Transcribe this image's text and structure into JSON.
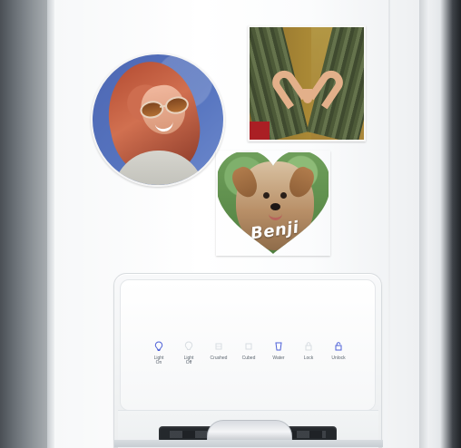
{
  "photo_magnets": {
    "heart_magnet": {
      "name_text": "Benji"
    }
  },
  "dispenser": {
    "controls": [
      {
        "label": "Light\nOn",
        "icon": "bulb-icon",
        "active": true
      },
      {
        "label": "Light\nOff",
        "icon": "bulb-off-icon",
        "active": false
      },
      {
        "label": "Crushed",
        "icon": "crushed-ice-icon",
        "active": false
      },
      {
        "label": "Cubed",
        "icon": "cubed-ice-icon",
        "active": false
      },
      {
        "label": "Water",
        "icon": "water-glass-icon",
        "active": true
      },
      {
        "label": "Lock",
        "icon": "lock-icon",
        "active": false
      },
      {
        "label": "Unlock",
        "icon": "unlock-icon",
        "active": true
      }
    ]
  },
  "colors": {
    "accent_blue": "#4e61d8",
    "label_gray": "#5d6670",
    "fridge_white": "#f7f8f9",
    "fridge_dark": "#1f2226"
  }
}
